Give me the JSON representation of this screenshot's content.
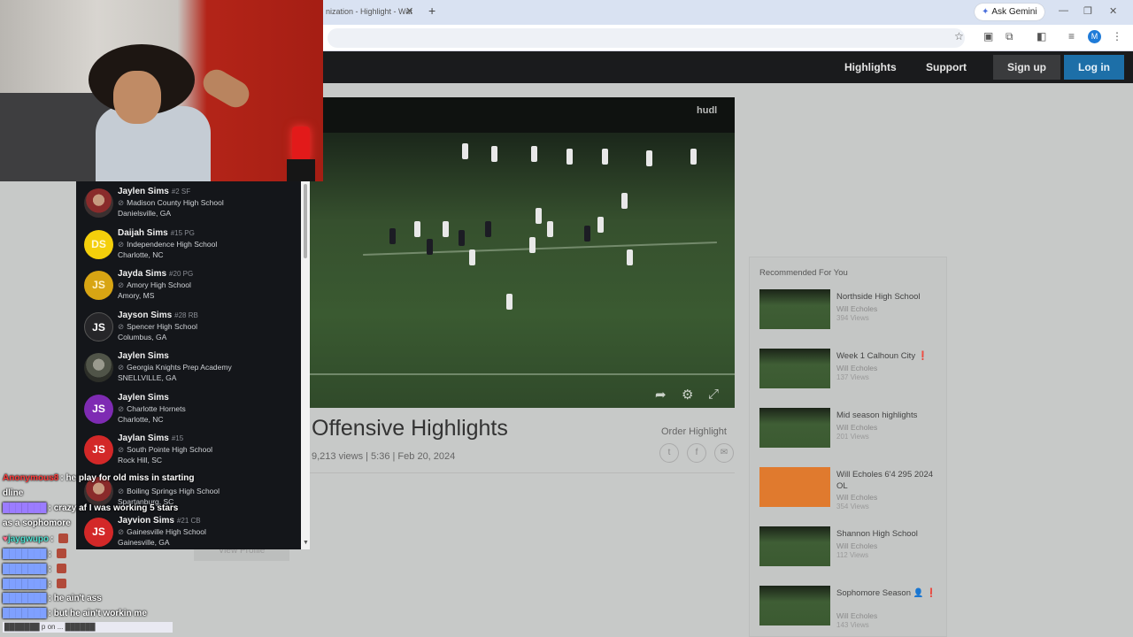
{
  "browser": {
    "tab_title": "nization - Highlight - Wat",
    "ask_gemini": "Ask Gemini",
    "profile_initial": "M"
  },
  "nav": {
    "highlights": "Highlights",
    "support": "Support",
    "signup": "Sign up",
    "login": "Log in"
  },
  "video": {
    "brand": "hudl",
    "title": "Offensive Highlights",
    "meta": "9,213 views | 5:36 | Feb 20, 2024",
    "order_label": "Order Highlight",
    "view_profile": "View Profile"
  },
  "recommended": {
    "title": "Recommended For You",
    "items": [
      {
        "name": "Northside High School",
        "author": "Will Echoles",
        "views": "394 Views",
        "thumb": "field"
      },
      {
        "name": "Week 1 Calhoun City ❗",
        "author": "Will Echoles",
        "views": "137 Views",
        "thumb": "field"
      },
      {
        "name": "Mid season highlights",
        "author": "Will Echoles",
        "views": "201 Views",
        "thumb": "field"
      },
      {
        "name": "Will Echoles 6'4 295 2024 OL",
        "author": "Will Echoles",
        "views": "354 Views",
        "thumb": "orange"
      },
      {
        "name": "Shannon High School",
        "author": "Will Echoles",
        "views": "112 Views",
        "thumb": "field"
      },
      {
        "name": "Sophomore Season 👤 ❗",
        "author": "Will Echoles",
        "views": "143 Views",
        "thumb": "field"
      }
    ]
  },
  "results": [
    {
      "name": "Jaylen Sims",
      "num": "#2 SF",
      "school": "Madison County High School",
      "loc": "Danielsville, GA",
      "avatar": "photo",
      "initials": ""
    },
    {
      "name": "Daijah Sims",
      "num": "#15 PG",
      "school": "Independence High School",
      "loc": "Charlotte, NC",
      "avatar": "yellow",
      "initials": "DS"
    },
    {
      "name": "Jayda Sims",
      "num": "#20 PG",
      "school": "Amory High School",
      "loc": "Amory, MS",
      "avatar": "gold",
      "initials": "JS"
    },
    {
      "name": "Jayson Sims",
      "num": "#28 RB",
      "school": "Spencer High School",
      "loc": "Columbus, GA",
      "avatar": "dark",
      "initials": "JS"
    },
    {
      "name": "Jaylen Sims",
      "num": "",
      "school": "Georgia Knights Prep Academy",
      "loc": "SNELLVILLE, GA",
      "avatar": "photo2",
      "initials": ""
    },
    {
      "name": "Jaylen Sims",
      "num": "",
      "school": "Charlotte Hornets",
      "loc": "Charlotte, NC",
      "avatar": "purple",
      "initials": "JS"
    },
    {
      "name": "Jaylan Sims",
      "num": "#15",
      "school": "South Pointe High School",
      "loc": "Rock Hill, SC",
      "avatar": "red",
      "initials": "JS"
    },
    {
      "name": "",
      "num": "",
      "school": "Boiling Springs High School",
      "loc": "Spartanburg, SC",
      "avatar": "photo",
      "initials": ""
    },
    {
      "name": "Jayvion Sims",
      "num": "#21 CB",
      "school": "Gainesville High School",
      "loc": "Gainesville, GA",
      "avatar": "red",
      "initials": "JS"
    }
  ],
  "chat": [
    {
      "user": "Anonymous8",
      "color": "red",
      "text": "he play for old miss in starting"
    },
    {
      "user": "",
      "color": "",
      "text": "dline"
    },
    {
      "user": "███████",
      "color": "purple",
      "text": "crazy af I was working 5 stars"
    },
    {
      "user": "",
      "color": "",
      "text": "as a sophomore"
    },
    {
      "user": "jaygwupo",
      "color": "teal",
      "text": ""
    },
    {
      "user": "███████",
      "color": "blue",
      "text": ""
    },
    {
      "user": "███████",
      "color": "blue",
      "text": ""
    },
    {
      "user": "███████",
      "color": "blue",
      "text": ""
    },
    {
      "user": "███████",
      "color": "blue",
      "text": "he ain't ass"
    },
    {
      "user": "███████",
      "color": "blue",
      "text": "but he ain't workin me"
    }
  ],
  "chat_input": "███████ p on ... ██████"
}
